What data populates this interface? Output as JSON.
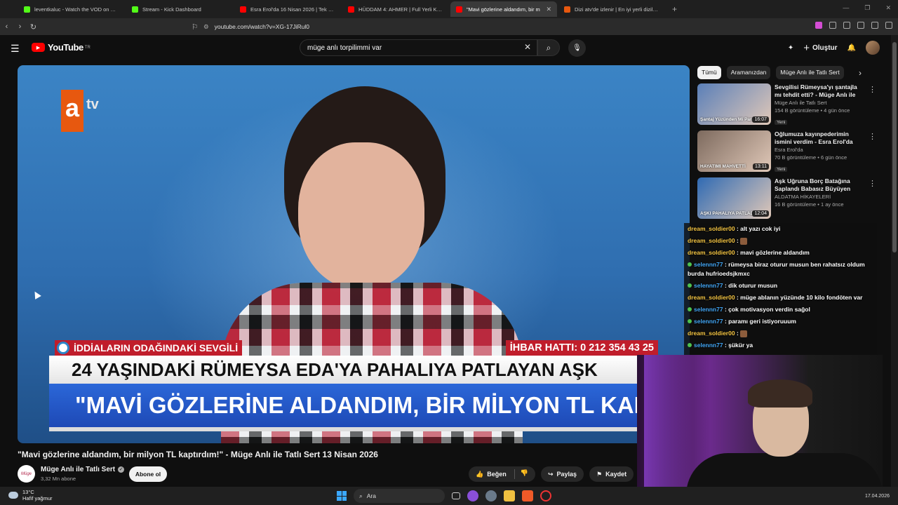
{
  "browser": {
    "tabs": [
      {
        "title": "leventkaluc - Watch the VOD on Kick",
        "color": "#53fc18"
      },
      {
        "title": "Stream - Kick Dashboard",
        "color": "#53fc18"
      },
      {
        "title": "Esra Erol'da 16 Nisan 2026 | Tek Parç...",
        "color": "#ff0000"
      },
      {
        "title": "HÜDDAM 4: AHMER | Full Yerli Korku...",
        "color": "#ff0000"
      },
      {
        "title": "\"Mavi gözlerine aldandım, bir m",
        "color": "#ff0000",
        "active": true
      },
      {
        "title": "Dizi atv'de izlenir | En iyi yerli diziler...",
        "color": "#e7580f"
      }
    ],
    "new_tab": "+",
    "url": "youtube.com/watch?v=XG-17JiRul0"
  },
  "youtube": {
    "logo_text": "YouTube",
    "logo_region": "TR",
    "search_query": "müge anlı torpilimmi var",
    "create_label": "Oluştur"
  },
  "video": {
    "channel_logo_a": "a",
    "channel_logo_tv": "tv",
    "tag_left": "İDDİALARIN ODAĞINDAKİ SEVGİLİ",
    "tag_right": "İHBAR HATTI: 0 212 354 43 25",
    "headline1": "24 YAŞINDAKİ RÜMEYSA EDA'YA PAHALIYA PATLAYAN AŞK",
    "headline2": "\"MAVİ GÖZLERİNE ALDANDIM, BİR MİLYON TL KAPTIRDIM\"",
    "title": "\"Mavi gözlerine aldandım, bir milyon TL kaptırdım!\" - Müge Anlı ile Tatlı Sert 13 Nisan 2026",
    "channel_name": "Müge Anlı ile Tatlı Sert",
    "subscribers": "3,32 Mn abone",
    "subscribe_label": "Abone ol",
    "like_label": "Beğen",
    "share_label": "Paylaş",
    "save_label": "Kaydet"
  },
  "sidebar": {
    "chips": [
      "Tümü",
      "Aramanızdan",
      "Müge Anlı ile Tatlı Sert"
    ],
    "recommendations": [
      {
        "title": "Sevgilisi Rümeysa'yı şantajla mı tehdit etti? - Müge Anlı ile Tatlı...",
        "channel": "Müge Anlı ile Tatlı Sert",
        "meta": "154 B görüntüleme • 4 gün önce",
        "badge": "Yeni",
        "duration": "16:07",
        "caption": "Şantaj Yüzünden Mi Para",
        "thumb_color": "#5a7fb8"
      },
      {
        "title": "Oğlumuza kayınpederimin ismini verdim - Esra Erol'da",
        "channel": "Esra Erol'da",
        "meta": "70 B görüntüleme • 6 gün önce",
        "badge": "Yeni",
        "duration": "13:11",
        "caption": "HAYATIMI MAHVETTİ",
        "thumb_color": "#7d6a5e"
      },
      {
        "title": "Aşk Uğruna Borç Batağına Saplandı Babasız Büyüyen Kız...",
        "channel": "ALDATMA HİKAYELERİ",
        "meta": "16 B görüntüleme • 1 ay önce",
        "badge": "",
        "duration": "12:04",
        "caption": "AŞKI PAHALIYA PATLADI",
        "thumb_color": "#2f6ab3"
      }
    ]
  },
  "chat": [
    {
      "user": "dream_soldier00",
      "text": "alt yazı cok iyi",
      "badge": false
    },
    {
      "user": "dream_soldier00",
      "text": "",
      "badge": false,
      "emote": true
    },
    {
      "user": "dream_soldier00",
      "text": "mavi gözlerine aldandım",
      "badge": false
    },
    {
      "user": "selennn77",
      "text": "rümeysa biraz oturur musun ben rahatsız oldum burda hufrioedsjkmxc",
      "badge": true
    },
    {
      "user": "selennn77",
      "text": "dik oturur musun",
      "badge": true
    },
    {
      "user": "dream_soldier00",
      "text": "müge ablanın yüzünde 10 kilo fondöten var",
      "badge": false
    },
    {
      "user": "selennn77",
      "text": "çok motivasyon verdin sağol",
      "badge": true
    },
    {
      "user": "selennn77",
      "text": "paramı geri istiyoruuum",
      "badge": true
    },
    {
      "user": "dream_soldier00",
      "text": "",
      "badge": false,
      "emote": true
    },
    {
      "user": "selennn77",
      "text": "şükür ya",
      "badge": true
    }
  ],
  "taskbar": {
    "temp": "13°C",
    "weather": "Hafif yağmur",
    "search_placeholder": "Ara",
    "date": "17.04.2026"
  }
}
